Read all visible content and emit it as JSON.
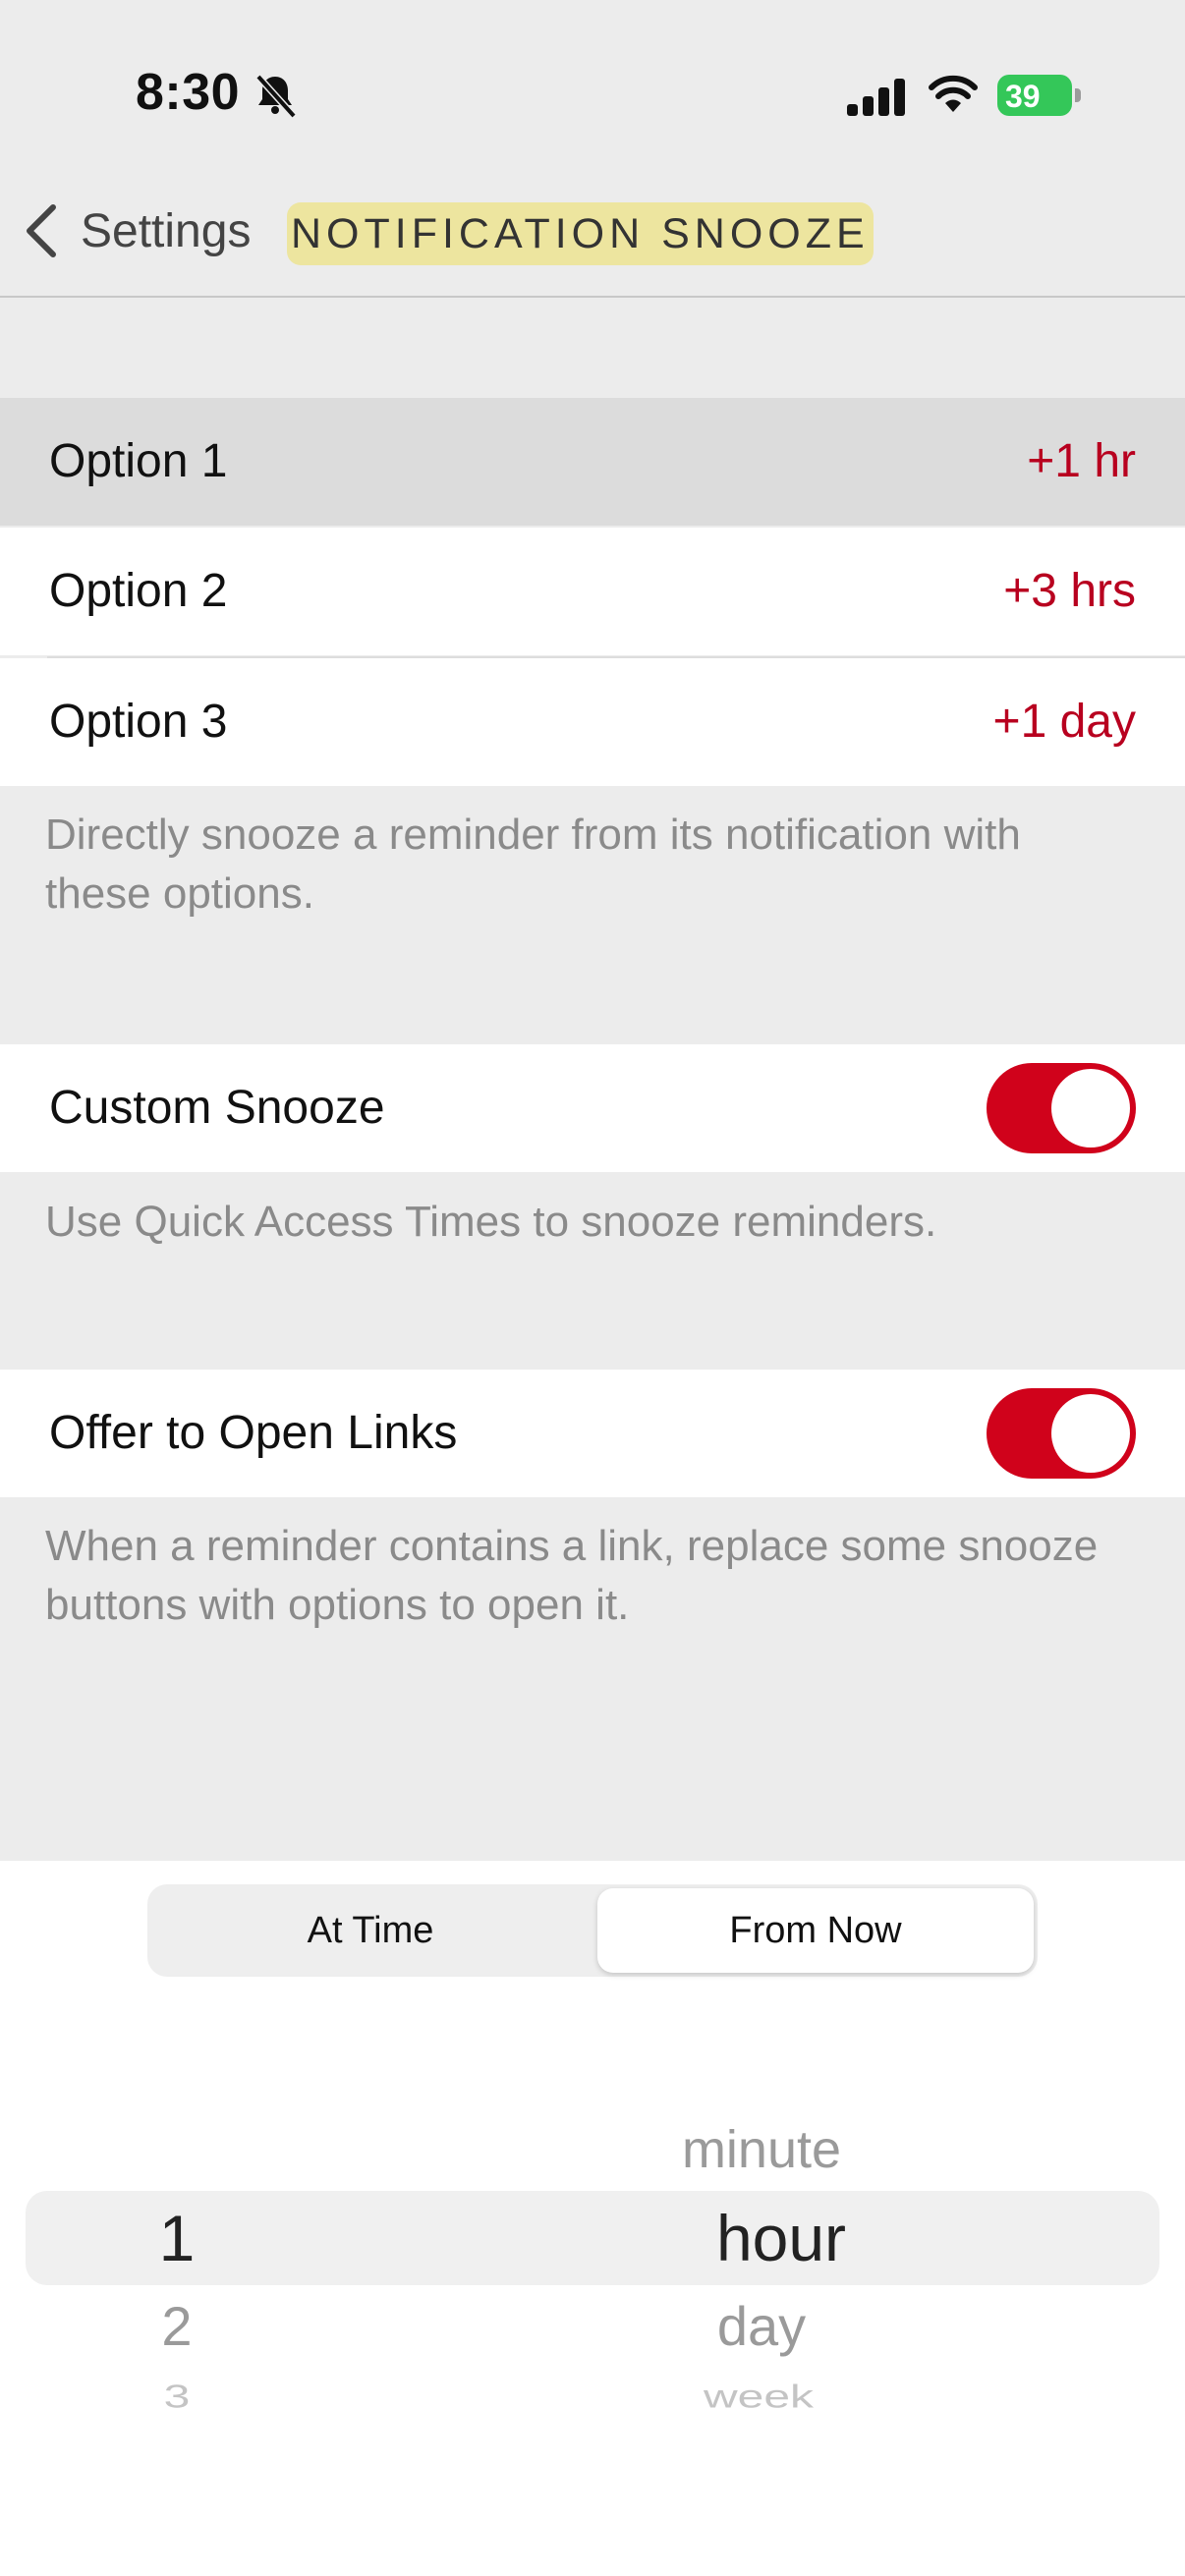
{
  "status_bar": {
    "time": "8:30",
    "battery": "39"
  },
  "nav": {
    "back_label": "Settings",
    "title": "NOTIFICATION SNOOZE"
  },
  "snooze_options": [
    {
      "label": "Option 1",
      "value": "+1 hr"
    },
    {
      "label": "Option 2",
      "value": "+3 hrs"
    },
    {
      "label": "Option 3",
      "value": "+1 day"
    }
  ],
  "snooze_options_footer": "Directly snooze a reminder from its notification with these options.",
  "custom_snooze": {
    "label": "Custom Snooze",
    "enabled": true,
    "footer": "Use Quick Access Times to snooze reminders."
  },
  "offer_links": {
    "label": "Offer to Open Links",
    "enabled": true,
    "footer": "When a reminder contains a link, replace some snooze buttons with options to open it."
  },
  "picker": {
    "segments": [
      "At Time",
      "From Now"
    ],
    "selected_segment": "From Now",
    "numbers": [
      "1",
      "2",
      "3"
    ],
    "units": [
      "minute",
      "hour",
      "day",
      "week"
    ],
    "selected_number": "1",
    "selected_unit": "hour"
  },
  "colors": {
    "accent": "#d0021b",
    "value_text": "#b8001f",
    "title_highlight": "#ede59f"
  }
}
